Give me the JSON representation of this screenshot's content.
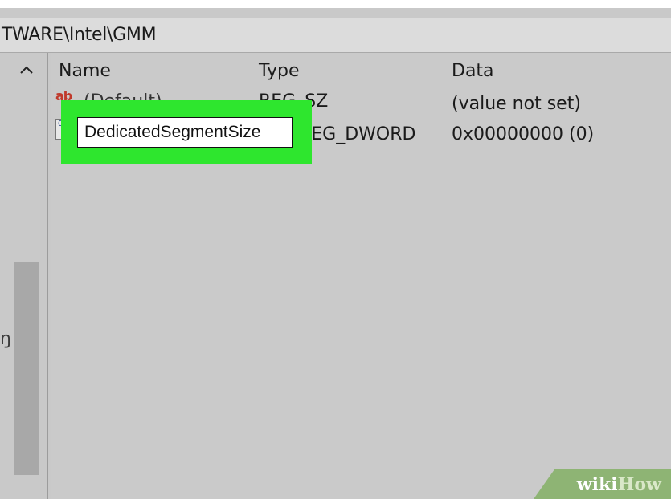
{
  "address": {
    "path": "TWARE\\Intel\\GMM"
  },
  "tree": {
    "fragment": "ŋ"
  },
  "columns": {
    "name": "Name",
    "type": "Type",
    "data": "Data"
  },
  "rows": [
    {
      "icon": "string-value-icon",
      "icon_glyph": "ab",
      "name": "(Default)",
      "type": "REG_SZ",
      "data": "(value not set)"
    },
    {
      "icon": "binary-value-icon",
      "icon_glyph": "011",
      "name": "",
      "type": "REG_DWORD",
      "type_visible": "WORD",
      "data": "0x00000000 (0)"
    }
  ],
  "rename": {
    "value": "DedicatedSegmentSize"
  },
  "watermark": {
    "part1": "wiki",
    "part2": "How"
  },
  "colors": {
    "highlight": "#2ee62e",
    "pane_bg": "#cacaca",
    "input_bg": "#ffffff",
    "watermark_bg": "#8eb474"
  }
}
